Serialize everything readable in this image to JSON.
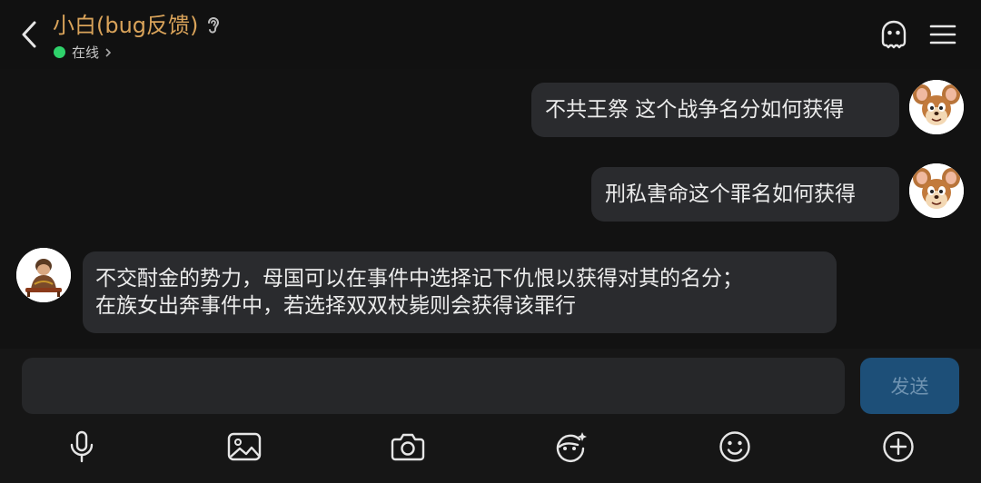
{
  "header": {
    "title": "小白(bug反馈)",
    "status": "在线",
    "icons": [
      "back-icon",
      "ear-icon",
      "status-chevron-icon",
      "ghost-icon",
      "menu-icon"
    ]
  },
  "messages": [
    {
      "side": "right",
      "text": "不共王祭  这个战争名分如何获得",
      "avatar": "jerry-mouse-avatar"
    },
    {
      "side": "right",
      "text": "刑私害命这个罪名如何获得",
      "avatar": "jerry-mouse-avatar"
    },
    {
      "side": "left",
      "line1": "不交酎金的势力，母国可以在事件中选择记下仇恨以获得对其的名分；",
      "line2": "在族女出奔事件中，若选择双双杖毙则会获得该罪行",
      "avatar": "character-avatar"
    }
  ],
  "composer": {
    "input_value": "",
    "send_label": "发送"
  },
  "toolbar": [
    "microphone-icon",
    "image-icon",
    "camera-icon",
    "sticker-icon",
    "emoji-icon",
    "plus-icon"
  ],
  "colors": {
    "background": "#121212",
    "title": "#d9a35a",
    "online": "#2fd26b",
    "bubble": "#2a2b2e",
    "send": "#1d4f78"
  }
}
